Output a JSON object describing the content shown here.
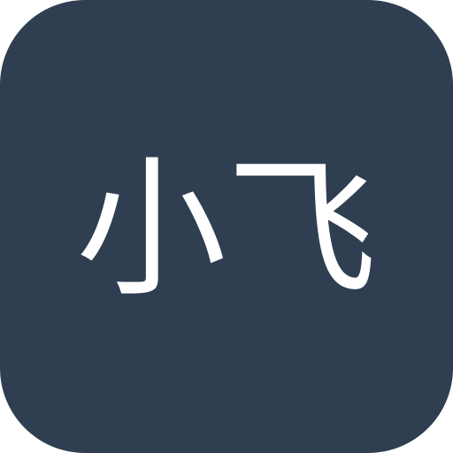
{
  "app_icon": {
    "label": "小飞",
    "background_color": "#2f3e50",
    "text_color": "#ffffff"
  }
}
